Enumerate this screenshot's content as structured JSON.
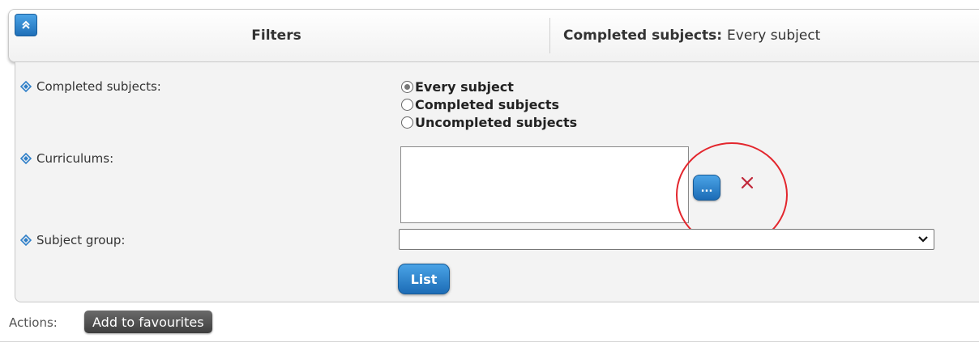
{
  "header": {
    "filters_title": "Filters",
    "summary_label": "Completed subjects:",
    "summary_value": "Every subject"
  },
  "filters": {
    "completed_subjects": {
      "label": "Completed subjects:",
      "options": [
        {
          "label": "Every subject",
          "checked": true
        },
        {
          "label": "Completed subjects",
          "checked": false
        },
        {
          "label": "Uncompleted subjects",
          "checked": false
        }
      ]
    },
    "curriculums": {
      "label": "Curriculums:",
      "value": "",
      "browse_label": "..."
    },
    "subject_group": {
      "label": "Subject group:",
      "selected": ""
    },
    "list_button": "List"
  },
  "actions": {
    "label": "Actions:",
    "favourites_button": "Add to favourites"
  },
  "colors": {
    "accent_blue": "#1f6fb8",
    "highlight_red": "#e3262d",
    "clear_red": "#c0283a"
  },
  "icons": [
    "chevrons-up-icon",
    "diamond-bullet-icon",
    "close-icon",
    "chevron-down-icon"
  ]
}
